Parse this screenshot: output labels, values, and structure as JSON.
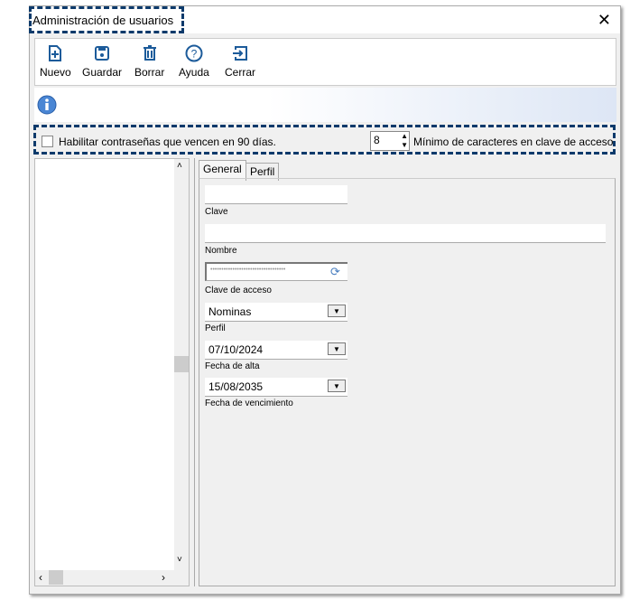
{
  "window": {
    "title": "Administración de usuarios"
  },
  "toolbar": {
    "nuevo": "Nuevo",
    "guardar": "Guardar",
    "borrar": "Borrar",
    "ayuda": "Ayuda",
    "cerrar": "Cerrar"
  },
  "options": {
    "enable_expiry": "Habilitar contraseñas que vencen en 90 días.",
    "min_chars_value": "8",
    "min_chars_label": "Mínimo de caracteres en clave de acceso"
  },
  "tabs": {
    "general": "General",
    "perfil": "Perfil"
  },
  "form": {
    "clave_label": "Clave",
    "clave_value": "",
    "nombre_label": "Nombre",
    "nombre_value": "",
    "acceso_label": "Clave de acceso",
    "acceso_value": "••••••••••••••••••••••••••••••••••",
    "perfil_label": "Perfil",
    "perfil_value": "Nominas",
    "alta_label": "Fecha de alta",
    "alta_value": "07/10/2024",
    "venc_label": "Fecha de vencimiento",
    "venc_value": "15/08/2035"
  }
}
